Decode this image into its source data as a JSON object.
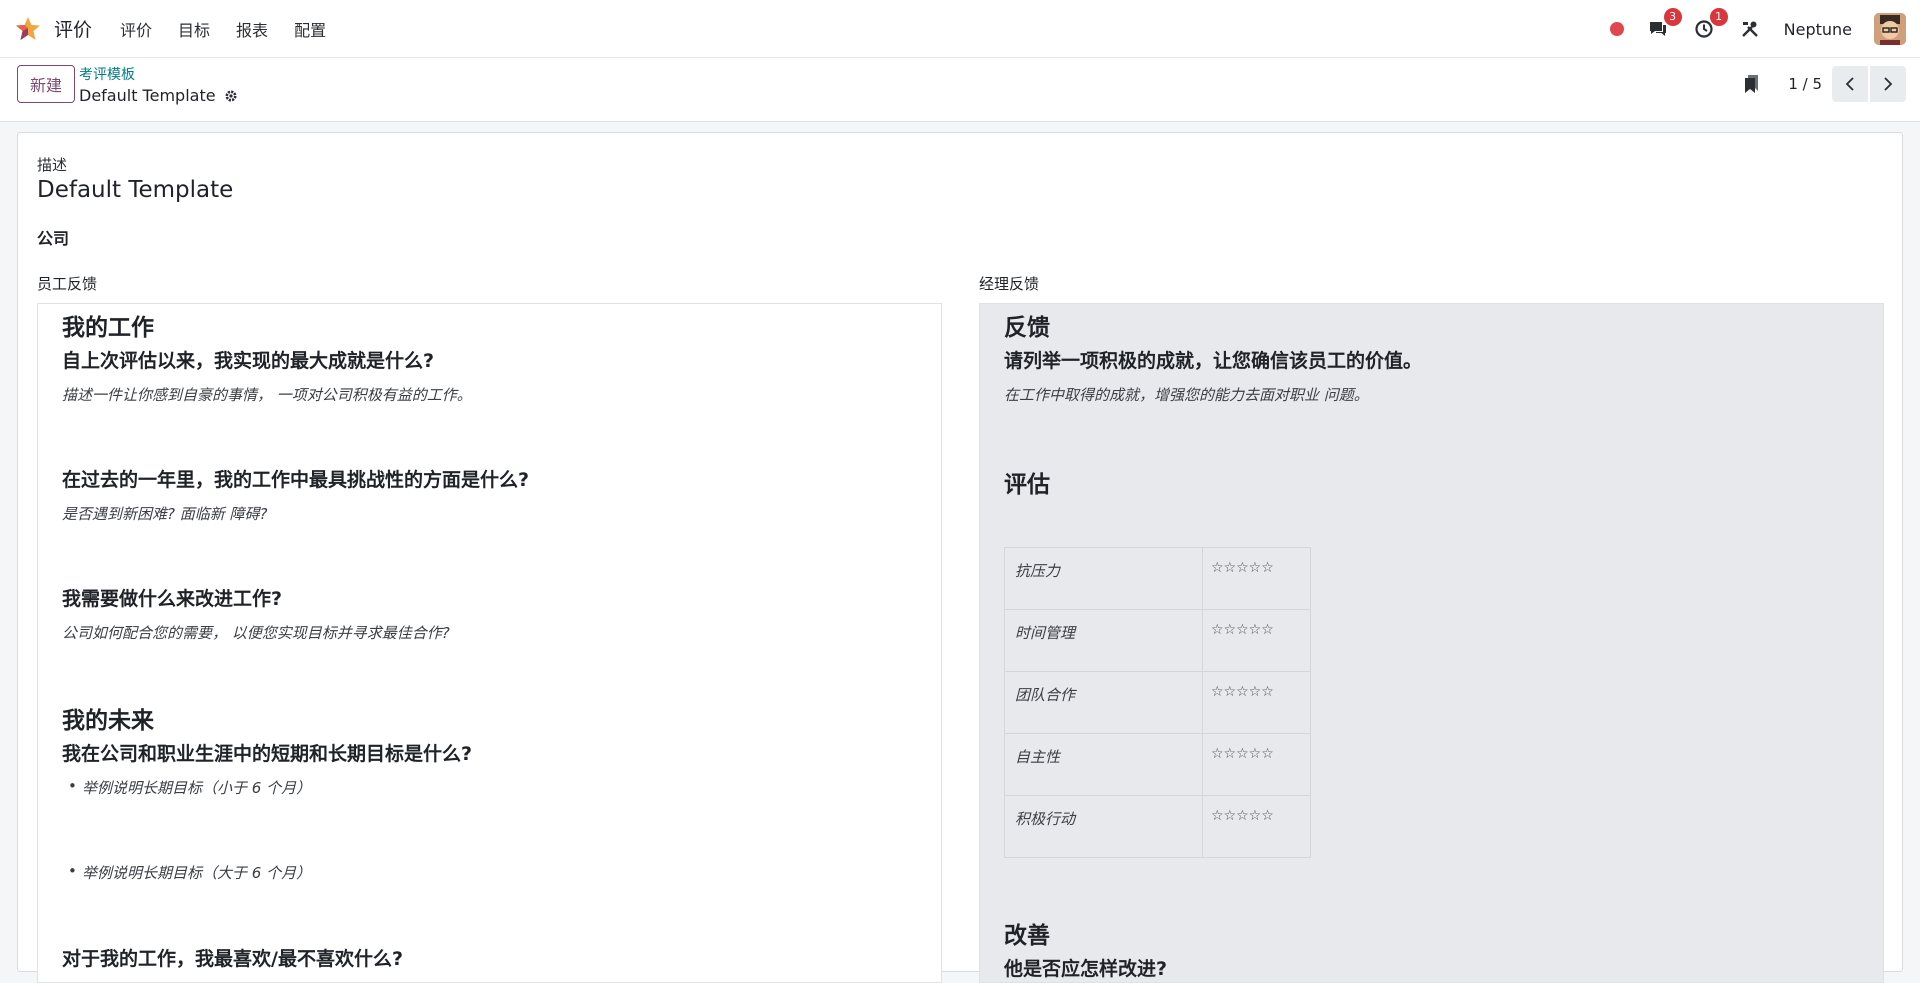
{
  "navbar": {
    "app_name": "评价",
    "menu": [
      "评价",
      "目标",
      "报表",
      "配置"
    ],
    "messages_badge": "3",
    "activity_badge": "1",
    "user_name": "Neptune",
    "status_color": "#e0474c"
  },
  "control": {
    "new_button": "新建",
    "breadcrumb_parent": "考评模板",
    "record_title": "Default Template",
    "pager": "1 / 5"
  },
  "form": {
    "description_label": "描述",
    "description_value": "Default Template",
    "company_label": "公司",
    "employee_feedback_label": "员工反馈",
    "manager_feedback_label": "经理反馈"
  },
  "employee": {
    "h_my_work": "我的工作",
    "q1": "自上次评估以来，我实现的最大成就是什么?",
    "q1_hint": "描述一件让你感到自豪的事情， 一项对公司积极有益的工作。",
    "q2": "在过去的一年里，我的工作中最具挑战性的方面是什么?",
    "q2_hint": "是否遇到新困难? 面临新 障碍?",
    "q3": "我需要做什么来改进工作?",
    "q3_hint": "公司如何配合您的需要， 以便您实现目标并寻求最佳合作?",
    "h_my_future": "我的未来",
    "q4": "我在公司和职业生涯中的短期和长期目标是什么?",
    "bullet1": "举例说明长期目标（小于 6 个月）",
    "bullet2": "举例说明长期目标（大于 6 个月）",
    "q5": "对于我的工作，我最喜欢/最不喜欢什么?"
  },
  "manager": {
    "h_feedback": "反馈",
    "q1": "请列举一项积极的成就，让您确信该员工的价值。",
    "q1_hint": "在工作中取得的成就，增强您的能力去面对职业 问题。",
    "h_evaluation": "评估",
    "ratings": [
      {
        "name": "抗压力",
        "stars": "☆☆☆☆☆"
      },
      {
        "name": "时间管理",
        "stars": "☆☆☆☆☆"
      },
      {
        "name": "团队合作",
        "stars": "☆☆☆☆☆"
      },
      {
        "name": "自主性",
        "stars": "☆☆☆☆☆"
      },
      {
        "name": "积极行动",
        "stars": "☆☆☆☆☆"
      }
    ],
    "h_improvement": "改善",
    "q2": "他是否应怎样改进?"
  }
}
